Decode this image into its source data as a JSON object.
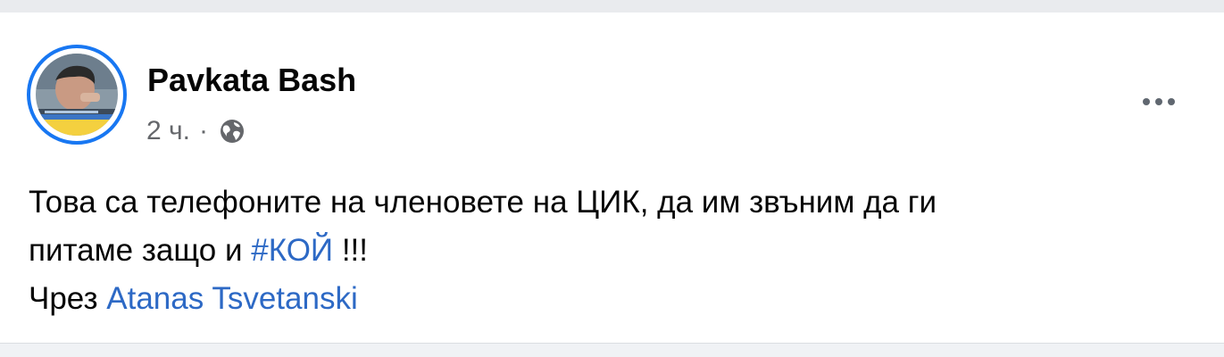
{
  "post": {
    "author": "Pavkata Bash",
    "time": "2 ч.",
    "separator": "·",
    "audience_icon": "globe-icon",
    "more_icon": "more-options-icon",
    "text_line1": "Това са телефоните на членовете на ЦИК, да им звъним да ги",
    "text_line2_prefix": "питаме защо и ",
    "hashtag": "#КОЙ",
    "text_line2_suffix": " !!!",
    "via_prefix": "Чрез ",
    "via_link": "Atanas Tsvetanski"
  },
  "colors": {
    "accent": "#1877f2",
    "link": "#2d69c5",
    "text": "#050505",
    "secondary": "#65676b"
  }
}
